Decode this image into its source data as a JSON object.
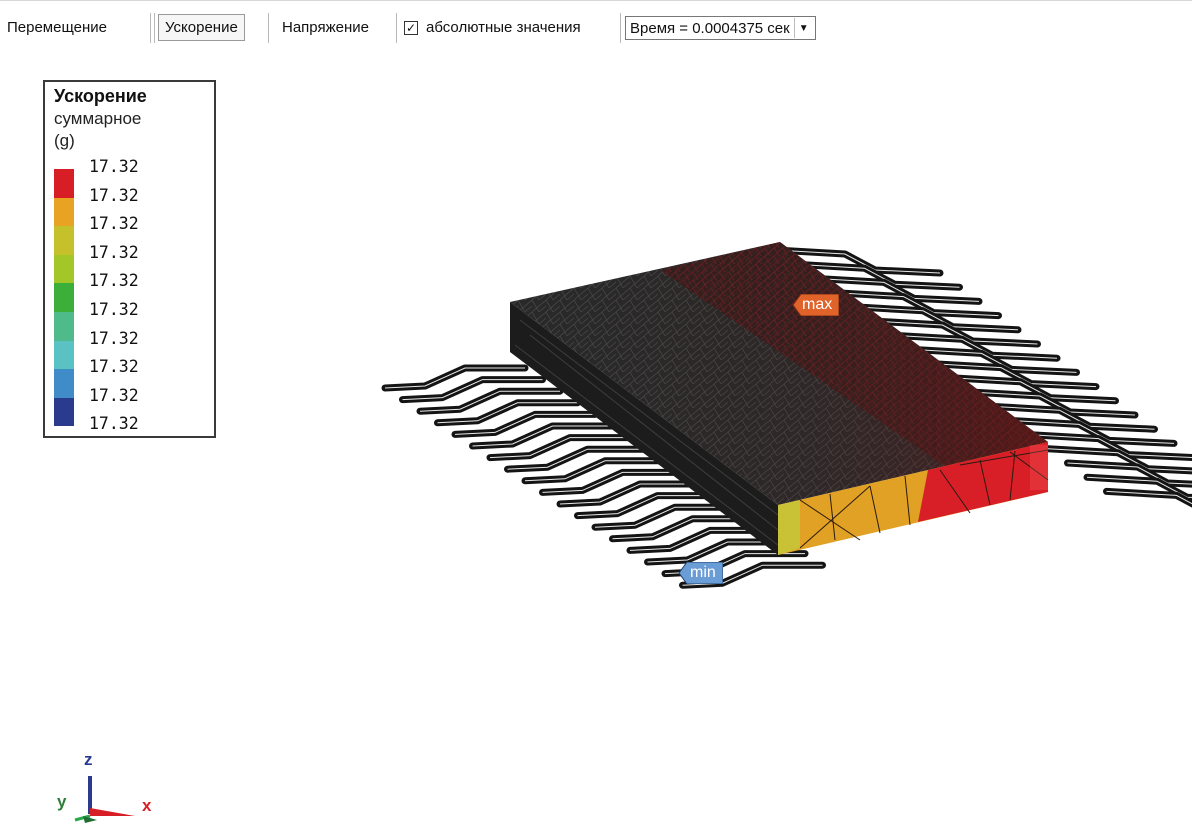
{
  "toolbar": {
    "tabs": [
      "Перемещение",
      "Ускорение",
      "Напряжение"
    ],
    "checkbox_label": "абсолютные значения",
    "checkbox_checked": true,
    "time_select": "Время = 0.0004375 сек"
  },
  "legend": {
    "title": "Ускорение",
    "subtitle": "суммарное",
    "unit": "(g)",
    "values": [
      "17.32",
      "17.32",
      "17.32",
      "17.32",
      "17.32",
      "17.32",
      "17.32",
      "17.32",
      "17.32",
      "17.32"
    ],
    "colors": [
      "#d71d26",
      "#e8a322",
      "#c5c12b",
      "#a3c728",
      "#3cae3a",
      "#4fba8a",
      "#5bc2c4",
      "#3f8cc9",
      "#2a3a8c"
    ]
  },
  "markers": {
    "max": "max",
    "min": "min"
  },
  "triad": {
    "z": "z",
    "y": "y",
    "x": "x"
  }
}
